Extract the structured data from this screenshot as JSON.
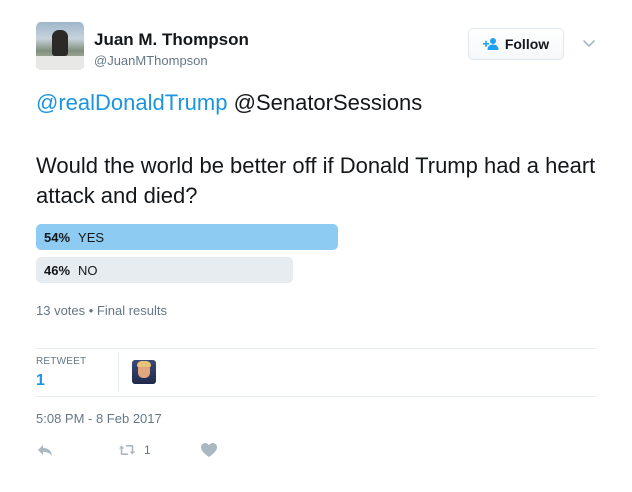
{
  "user": {
    "name": "Juan M. Thompson",
    "handle": "@JuanMThompson"
  },
  "follow": {
    "label": "Follow"
  },
  "tweet": {
    "mention_1": "@realDonaldTrump",
    "mention_2": "@SenatorSessions",
    "text": "Would the world be better off if Donald Trump had a heart attack and died?"
  },
  "poll": {
    "options": [
      {
        "percent_label": "54%",
        "label": "YES",
        "fraction": 0.54
      },
      {
        "percent_label": "46%",
        "label": "NO",
        "fraction": 0.46
      }
    ],
    "meta": "13 votes • Final results"
  },
  "stats": {
    "retweet_label": "RETWEET",
    "retweet_count": "1"
  },
  "timestamp": "5:08 PM - 8 Feb 2017",
  "actions": {
    "retweet_count": "1"
  },
  "colors": {
    "link": "#1b95e0",
    "poll_winner": "#8ecbf2",
    "poll_other": "#e6ecf0",
    "muted": "#657786"
  },
  "icons": {
    "follow": "add-user-icon",
    "menu": "chevron-down-icon",
    "reply": "reply-icon",
    "retweet": "retweet-icon",
    "like": "heart-icon"
  }
}
